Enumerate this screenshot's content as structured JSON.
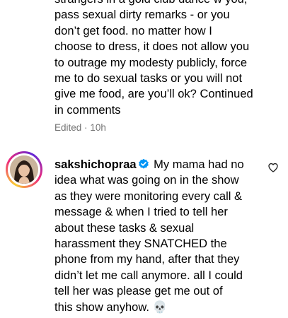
{
  "comment_1": {
    "text_lines": [
      "strangers in a gold club dance w you,",
      "pass sexual dirty remarks - or you",
      "don’t get food. no matter how I",
      "choose to dress, it does not allow you",
      "to outrage my modesty publicly, force",
      "me to do sexual tasks or you will not",
      "give me food, are you’ll ok? Continued",
      "in comments"
    ],
    "edited_label": "Edited",
    "separator": "·",
    "time": "10h"
  },
  "comment_2": {
    "username": "sakshichopraa",
    "verified": true,
    "text_lines": [
      "My mama had no",
      "idea what was going on in the show",
      "as they were monitoring every call &",
      "message & when I tried to tell her",
      "about these tasks & sexual",
      "harassment they SNATCHED the",
      "phone from my hand, after that they",
      "didn’t let me call anymore. all I could",
      "tell her was please get me out of",
      "this show anyhow."
    ],
    "emoji": "💀",
    "like_icon": "heart-outline-icon"
  },
  "colors": {
    "text": "#000000",
    "meta": "#737373",
    "verified": "#0095f6"
  }
}
